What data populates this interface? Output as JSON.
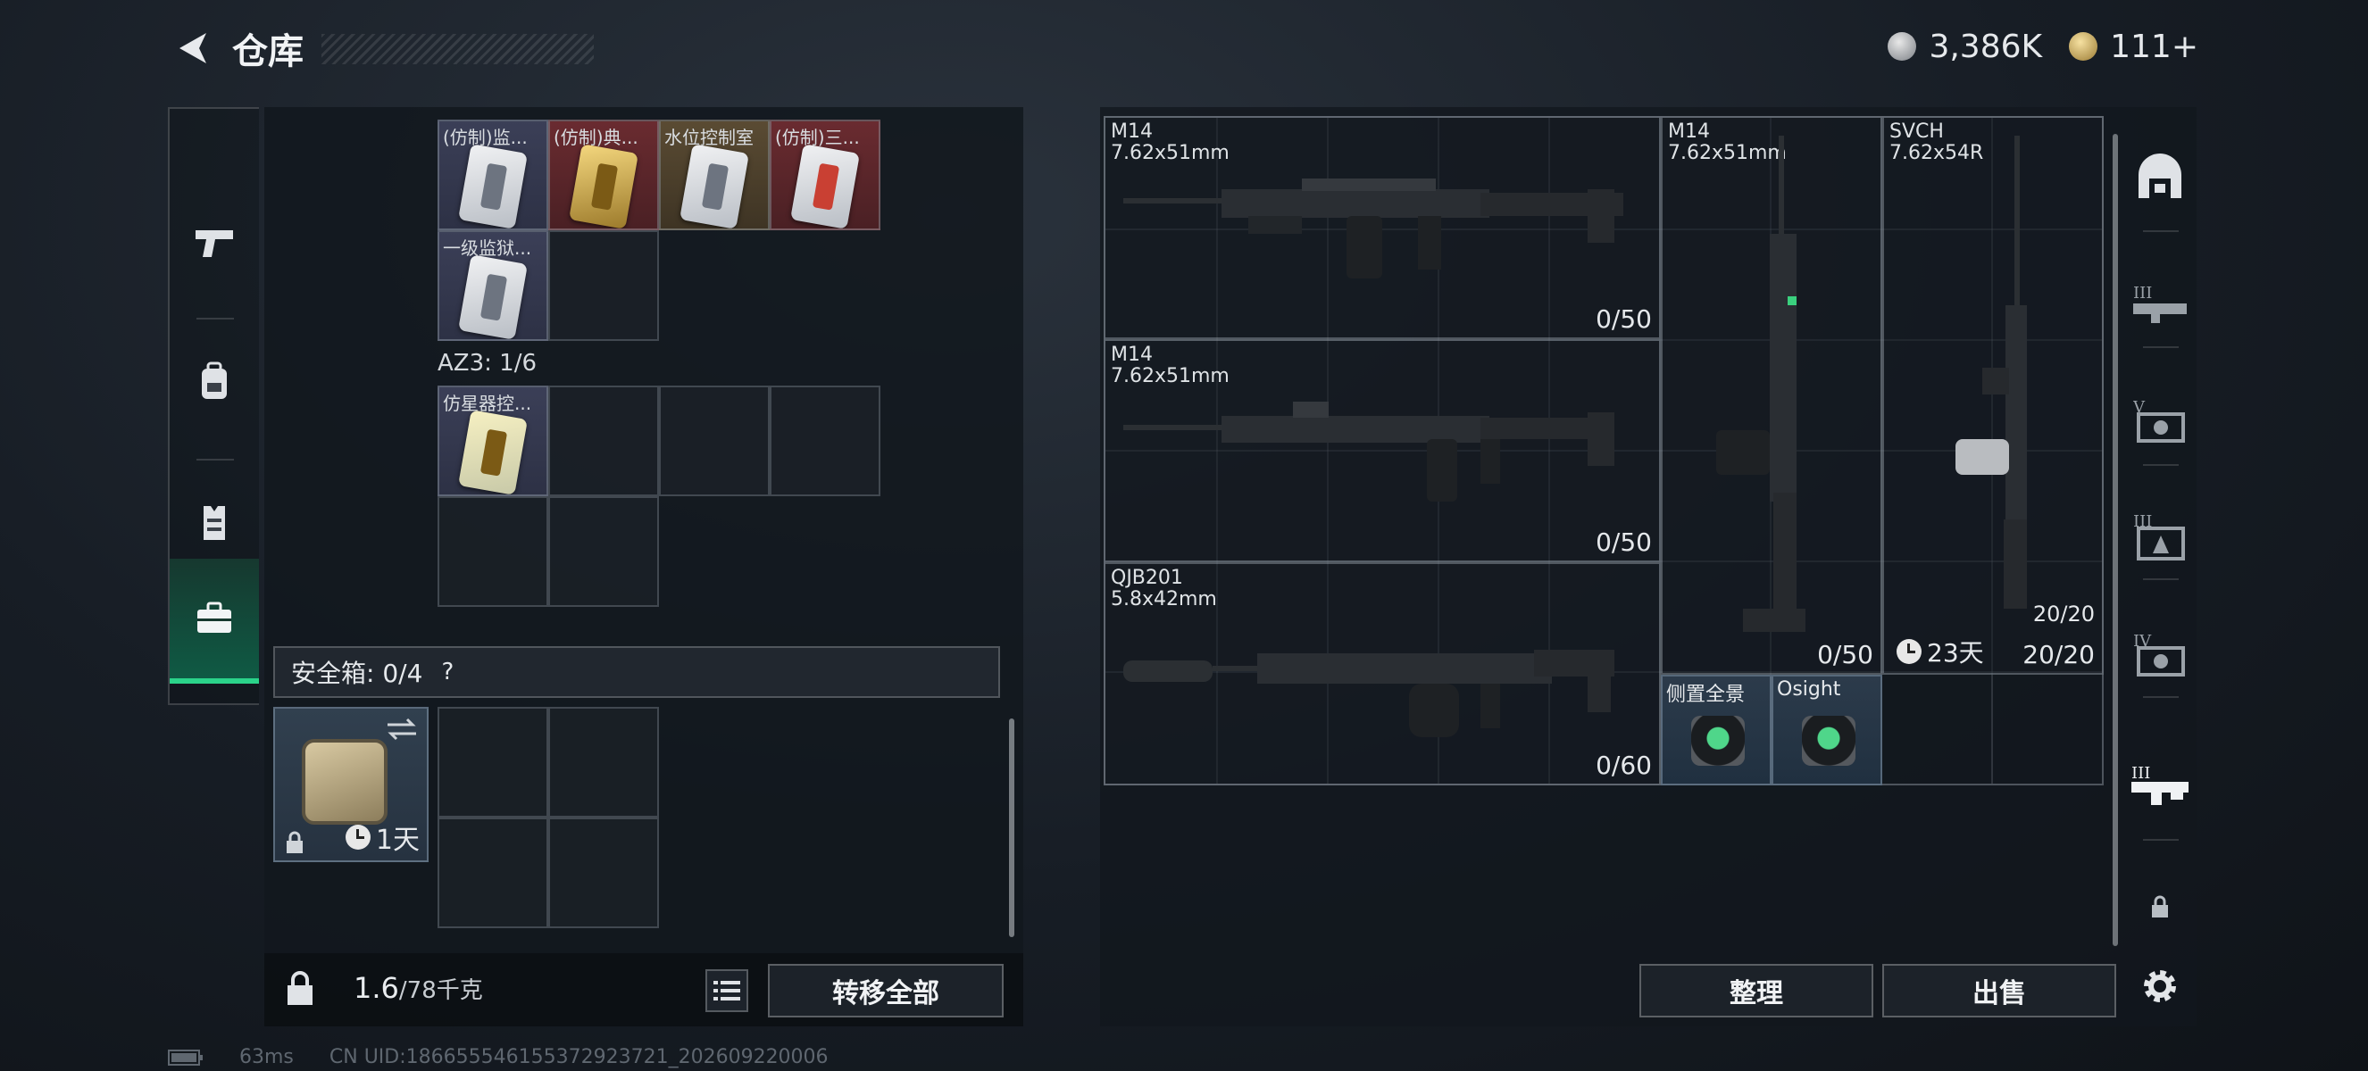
{
  "header": {
    "title": "仓库",
    "currency_silver": "3,386K",
    "currency_gold": "111+"
  },
  "left_rail": {
    "items": [
      "pistol-icon",
      "backpack-icon",
      "vest-icon",
      "toolbox-icon"
    ],
    "active_index": 3
  },
  "container_items": [
    {
      "label": "(仿制)监..."
    },
    {
      "label": "(仿制)典..."
    },
    {
      "label": "水位控制室"
    },
    {
      "label": "(仿制)三..."
    },
    {
      "label": "一级监狱..."
    }
  ],
  "az3": {
    "label": "AZ3: 1/6",
    "items": [
      {
        "label": "仿星器控..."
      }
    ]
  },
  "safebox": {
    "label": "安全箱: 0/4",
    "help": "?",
    "timer": "1天"
  },
  "bottom": {
    "weight": "1.6",
    "weight_max": "/78千克",
    "transfer_label": "转移全部"
  },
  "weapons": [
    {
      "name": "M14",
      "caliber": "7.62x51mm",
      "ammo": "0/50"
    },
    {
      "name": "M14",
      "caliber": "7.62x51mm",
      "ammo": "0/50"
    },
    {
      "name": "QJB201",
      "caliber": "5.8x42mm",
      "ammo": "0/60"
    },
    {
      "name": "M14",
      "caliber": "7.62x51mm",
      "ammo": "0/50"
    },
    {
      "name": "SVCH",
      "caliber": "7.62x54R",
      "ammo": "20/20",
      "ammo_top": "20/20",
      "timer": "23天"
    }
  ],
  "attachments": [
    {
      "label": "侧置全景"
    },
    {
      "label": "Osight"
    }
  ],
  "actions": {
    "sort_label": "整理",
    "sell_label": "出售"
  },
  "right_rail": {
    "items": [
      "home-icon",
      "tier3-gun-icon",
      "tier5-icon",
      "tier3-icon",
      "tier4-icon",
      "gun-rack-icon",
      "lock-icon",
      "gear-icon"
    ]
  },
  "footer": {
    "ping": "63ms",
    "uid": "CN UID:1866555461553729237​21_202609220006"
  },
  "colors": {
    "accent_green": "#2bd38a",
    "panel": "#12171d"
  }
}
